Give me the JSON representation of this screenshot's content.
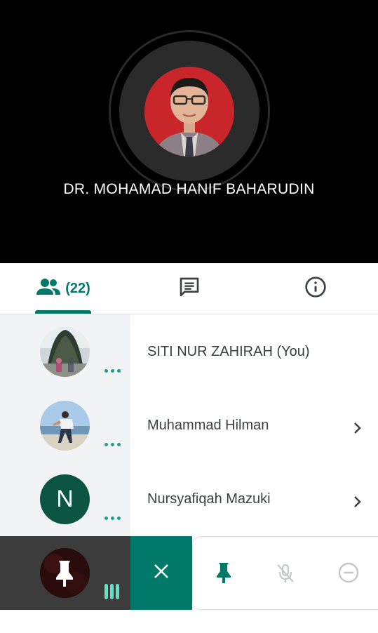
{
  "speaker": {
    "name": "DR. MOHAMAD HANIF BAHARUDIN"
  },
  "tabs": {
    "people_count": "(22)",
    "active_color": "#00796b",
    "icons": [
      "people-icon",
      "chat-icon",
      "info-icon"
    ]
  },
  "participants": [
    {
      "name": "SITI NUR ZAHIRAH (You)",
      "avatar": "photo",
      "has_chevron": false
    },
    {
      "name": "Muhammad Hilman",
      "avatar": "photo",
      "has_chevron": true
    },
    {
      "name": "Nursyafiqah Mazuki",
      "avatar": "N",
      "avatar_color": "#0b5442",
      "has_chevron": true
    }
  ],
  "bottom_bar": {
    "icons": [
      "pin-icon",
      "close-icon",
      "pin-icon",
      "mic-off-icon",
      "remove-icon"
    ]
  }
}
